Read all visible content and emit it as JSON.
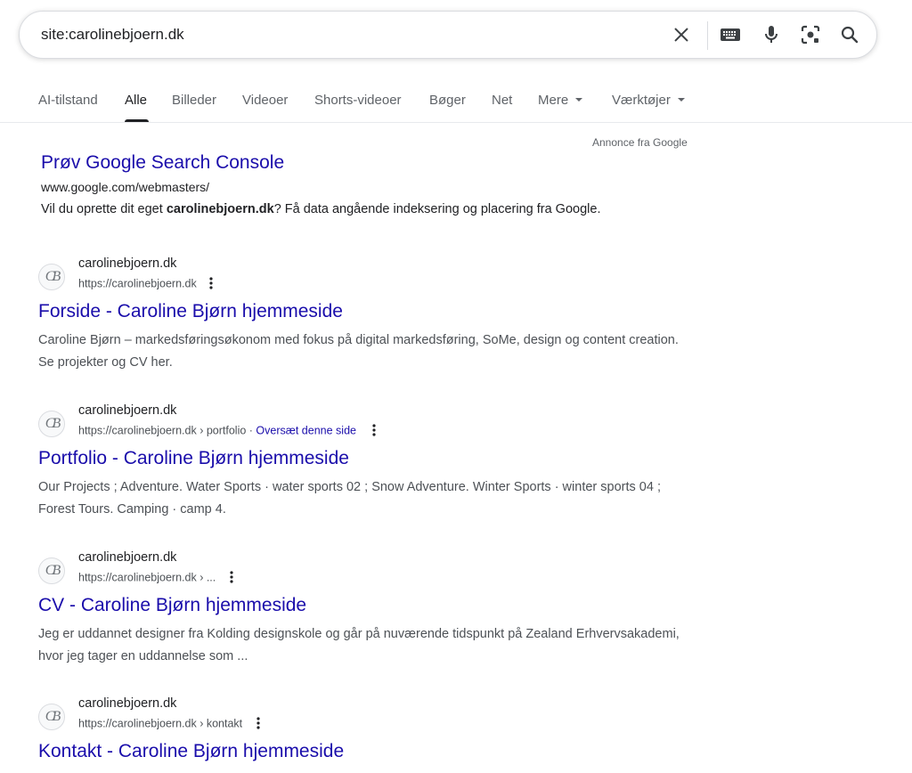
{
  "search": {
    "query": "site:carolinebjoern.dk"
  },
  "tabs": [
    {
      "label": "AI-tilstand"
    },
    {
      "label": "Alle"
    },
    {
      "label": "Billeder"
    },
    {
      "label": "Videoer"
    },
    {
      "label": "Shorts-videoer"
    },
    {
      "label": "Bøger"
    },
    {
      "label": "Net"
    },
    {
      "label": "Mere"
    },
    {
      "label": "Værktøjer"
    }
  ],
  "ad": {
    "label": "Annonce fra Google",
    "title": "Prøv Google Search Console",
    "url": "www.google.com/webmasters/",
    "desc_pre": "Vil du oprette dit eget ",
    "desc_bold": "carolinebjoern.dk",
    "desc_post": "? Få data angående indeksering og placering fra Google."
  },
  "results": [
    {
      "site": "carolinebjoern.dk",
      "url": "https://carolinebjoern.dk",
      "translate": "",
      "title": "Forside - Caroline Bjørn hjemmeside",
      "snippet": "Caroline Bjørn – markedsføringsøkonom med fokus på digital markedsføring, SoMe, design og content creation. Se projekter og CV her."
    },
    {
      "site": "carolinebjoern.dk",
      "url": "https://carolinebjoern.dk › portfolio",
      "translate": "Oversæt denne side",
      "title": "Portfolio - Caroline Bjørn hjemmeside",
      "snippet": "Our Projects ; Adventure. Water Sports · water sports 02 ; Snow Adventure. Winter Sports · winter sports 04 ; Forest Tours. Camping · camp 4."
    },
    {
      "site": "carolinebjoern.dk",
      "url": "https://carolinebjoern.dk › ...",
      "translate": "",
      "title": "CV - Caroline Bjørn hjemmeside",
      "snippet": "Jeg er uddannet designer fra Kolding designskole og går på nuværende tidspunkt på Zealand Erhvervsakademi, hvor jeg tager en uddannelse som ..."
    },
    {
      "site": "carolinebjoern.dk",
      "url": "https://carolinebjoern.dk › kontakt",
      "translate": "",
      "title": "Kontakt - Caroline Bjørn hjemmeside",
      "snippet": ""
    }
  ],
  "favicon_text": "CB",
  "colors": {
    "link": "#1a0dab",
    "text": "#202124",
    "muted": "#4d5156",
    "icon": "#3c4043"
  },
  "icons": {
    "clear": "close-icon",
    "keyboard": "keyboard-icon",
    "voice": "microphone-icon",
    "lens": "camera-lens-icon",
    "search": "search-icon"
  }
}
